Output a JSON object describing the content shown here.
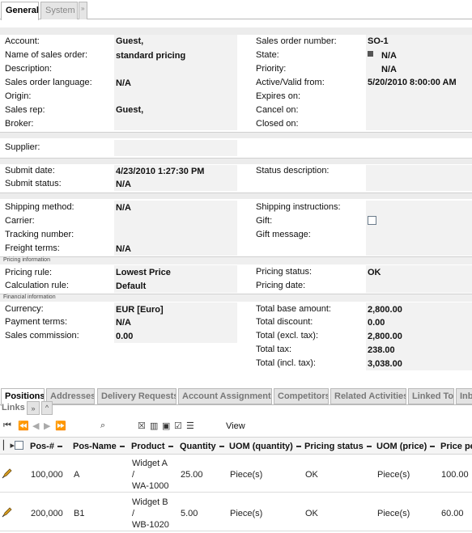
{
  "tabs": {
    "general": "General",
    "system": "System",
    "more": "»"
  },
  "col1": [
    {
      "label": "Account:",
      "value": "Guest,"
    },
    {
      "label": "Name of sales order:",
      "value": "standard pricing"
    },
    {
      "label": "Description:",
      "value": ""
    },
    {
      "label": "Sales order language:",
      "value": "N/A"
    },
    {
      "label": "Origin:",
      "value": ""
    },
    {
      "label": "Sales rep:",
      "value": "Guest,"
    },
    {
      "label": "Broker:",
      "value": ""
    }
  ],
  "col2": [
    {
      "label": "Sales order number:",
      "value": "SO-1"
    },
    {
      "label": "State:",
      "value": "N/A"
    },
    {
      "label": "Priority:",
      "value": "N/A"
    },
    {
      "label": "Active/Valid from:",
      "value": "5/20/2010 8:00:00 AM"
    },
    {
      "label": "Expires on:",
      "value": ""
    },
    {
      "label": "Cancel on:",
      "value": ""
    },
    {
      "label": "Closed on:",
      "value": ""
    }
  ],
  "supplier": {
    "label": "Supplier:",
    "value": ""
  },
  "submit": {
    "date_label": "Submit date:",
    "date_value": "4/23/2010 1:27:30 PM",
    "status_label": "Submit status:",
    "status_value": "N/A",
    "desc_label": "Status description:",
    "desc_value": ""
  },
  "shipping": {
    "method_label": "Shipping method:",
    "method_value": "N/A",
    "carrier_label": "Carrier:",
    "tracking_label": "Tracking number:",
    "freight_label": "Freight terms:",
    "freight_value": "N/A",
    "instr_label": "Shipping instructions:",
    "gift_label": "Gift:",
    "giftmsg_label": "Gift message:"
  },
  "pricing": {
    "section": "Pricing information",
    "rule_label": "Pricing rule:",
    "rule_value": "Lowest Price",
    "calc_label": "Calculation rule:",
    "calc_value": "Default",
    "status_label": "Pricing status:",
    "status_value": "OK",
    "date_label": "Pricing date:",
    "date_value": ""
  },
  "financial": {
    "section": "Financial information",
    "currency_label": "Currency:",
    "currency_value": "EUR [Euro]",
    "payment_label": "Payment terms:",
    "payment_value": "N/A",
    "commission_label": "Sales commission:",
    "commission_value": "0.00",
    "base_label": "Total base amount:",
    "base_value": "2,800.00",
    "discount_label": "Total discount:",
    "discount_value": "0.00",
    "excl_label": "Total (excl. tax):",
    "excl_value": "2,800.00",
    "tax_label": "Total tax:",
    "tax_value": "238.00",
    "incl_label": "Total (incl. tax):",
    "incl_value": "3,038.00"
  },
  "positions_tabs": [
    "Positions",
    "Addresses",
    "Delivery Requests",
    "Account Assignments",
    "Competitors",
    "Related Activities",
    "Linked To",
    "Inb"
  ],
  "positions_tabs2": [
    "Links",
    "»",
    "^"
  ],
  "toolbar": {
    "view": "View"
  },
  "table": {
    "headers": [
      "Pos-#",
      "Pos-Name",
      "Product",
      "Quantity",
      "UOM (quantity)",
      "Pricing status",
      "UOM (price)",
      "Price pe"
    ],
    "rows": [
      {
        "pos": "100,000",
        "name": "A",
        "product": [
          "Widget A",
          "/",
          "WA-1000"
        ],
        "qty": "25.00",
        "uomq": "Piece(s)",
        "status": "OK",
        "uomp": "Piece(s)",
        "price": "100.00"
      },
      {
        "pos": "200,000",
        "name": "B1",
        "product": [
          "Widget B",
          "/",
          "WB-1020"
        ],
        "qty": "5.00",
        "uomq": "Piece(s)",
        "status": "OK",
        "uomp": "Piece(s)",
        "price": "60.00"
      }
    ]
  }
}
